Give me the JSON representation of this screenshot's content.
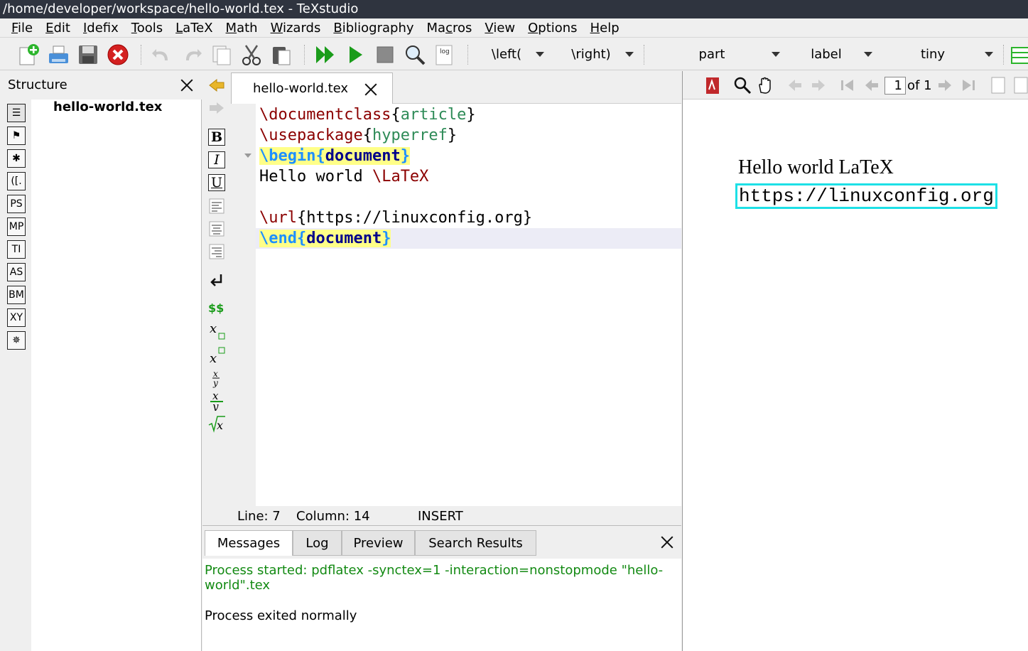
{
  "window": {
    "title": "/home/developer/workspace/hello-world.tex - TeXstudio"
  },
  "menu": [
    {
      "pre": "",
      "u": "F",
      "post": "ile"
    },
    {
      "pre": "",
      "u": "E",
      "post": "dit"
    },
    {
      "pre": "",
      "u": "I",
      "post": "defix"
    },
    {
      "pre": "",
      "u": "T",
      "post": "ools"
    },
    {
      "pre": "",
      "u": "L",
      "post": "aTeX"
    },
    {
      "pre": "",
      "u": "M",
      "post": "ath"
    },
    {
      "pre": "",
      "u": "W",
      "post": "izards"
    },
    {
      "pre": "",
      "u": "B",
      "post": "ibliography"
    },
    {
      "pre": "Ma",
      "u": "c",
      "post": "ros"
    },
    {
      "pre": "",
      "u": "V",
      "post": "iew"
    },
    {
      "pre": "",
      "u": "O",
      "post": "ptions"
    },
    {
      "pre": "",
      "u": "H",
      "post": "elp"
    }
  ],
  "toolbar": {
    "left_combo": "\\left(",
    "right_combo": "\\right)",
    "section_combo": "part",
    "ref_combo": "label",
    "size_combo": "tiny",
    "log_label": "log"
  },
  "structure": {
    "title": "Structure",
    "file": "hello-world.tex",
    "icons": [
      "☰",
      "⚑",
      "✱",
      "([.",
      "PS",
      "MP",
      "TI",
      "AS",
      "BM",
      "XY",
      "✵"
    ]
  },
  "editor": {
    "tab_label": "hello-world.tex",
    "lines": {
      "l1_cmd": "\\documentclass",
      "l1_arg": "article",
      "l2_cmd": "\\usepackage",
      "l2_arg": "hyperref",
      "l3_cmd": "\\begin",
      "l3_env": "document",
      "l4_text": "Hello world ",
      "l4_cmd": "\\LaTeX",
      "l6_cmd": "\\url",
      "l6_text": "https://linuxconfig.org",
      "l7_cmd": "\\end",
      "l7_env": "document"
    },
    "format_buttons": {
      "bold": "B",
      "italic": "I",
      "underline": "U"
    }
  },
  "status": {
    "line": "Line: 7",
    "column": "Column: 14",
    "mode": "INSERT"
  },
  "messages": {
    "tabs": [
      "Messages",
      "Log",
      "Preview",
      "Search Results"
    ],
    "started": "Process started: pdflatex -synctex=1 -interaction=nonstopmode \"hello-world\".tex",
    "exited": "Process exited normally"
  },
  "pdf": {
    "page": "1",
    "of": "of 1",
    "hello": "Hello world ",
    "latex": "LaTeX",
    "url": "https://linuxconfig.org"
  },
  "colors": {
    "accent_cyan": "#1de0e6",
    "titlebar": "#2f343f",
    "green": "#138a13",
    "cmd": "#8b0000"
  }
}
